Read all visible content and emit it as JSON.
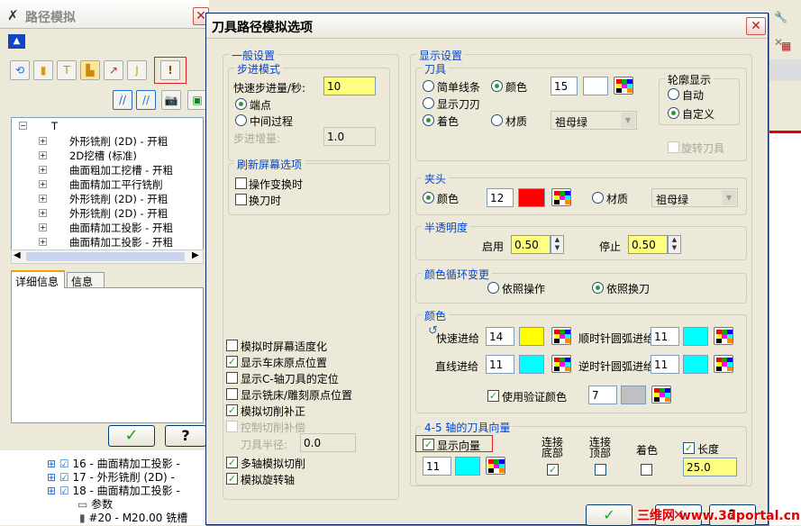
{
  "left_window": {
    "title": "路径模拟",
    "tree_root": "T",
    "tree_items": [
      "外形铣削 (2D) - 开粗",
      "2D挖槽 (标准)",
      "曲面粗加工挖槽 - 开粗",
      "曲面精加工平行铣削",
      "外形铣削 (2D) - 开粗",
      "外形铣削 (2D) - 开粗",
      "曲面精加工投影 - 开粗",
      "曲面精加工投影 - 开粗"
    ],
    "tabs": [
      "详细信息",
      "信息"
    ],
    "ok_icon": "check-icon",
    "help_icon": "question-icon"
  },
  "bottom_tree": [
    {
      "text": "16 - 曲面精加工投影 -"
    },
    {
      "text": "17 - 外形铣削 (2D) -"
    },
    {
      "text": "18 - 曲面精加工投影 -"
    },
    {
      "text": "参数"
    },
    {
      "text": "#20 - M20.00 铣槽"
    }
  ],
  "dialog": {
    "title": "刀具路径模拟选项",
    "general": {
      "title": "一般设置",
      "step_mode": {
        "title": "步进模式",
        "rapid_label": "快速步进量/秒:",
        "rapid_value": "10",
        "endpoint": "端点",
        "intermediate": "中间过程",
        "step_inc_label": "步进增量:",
        "step_inc_value": "1.0"
      },
      "refresh": {
        "title": "刷新屏幕选项",
        "op_change": "操作变换时",
        "tool_change": "换刀时"
      },
      "options": [
        {
          "label": "模拟时屏幕适度化",
          "checked": false,
          "disabled": false
        },
        {
          "label": "显示车床原点位置",
          "checked": true,
          "disabled": false
        },
        {
          "label": "显示C-轴刀具的定位",
          "checked": false,
          "disabled": false
        },
        {
          "label": "显示铣床/雕刻原点位置",
          "checked": false,
          "disabled": false
        },
        {
          "label": "模拟切削补正",
          "checked": true,
          "disabled": false
        },
        {
          "label": "控制切削补偿",
          "checked": false,
          "disabled": true
        }
      ],
      "tool_radius_label": "刀具半径:",
      "tool_radius_value": "0.0",
      "options2": [
        {
          "label": "多轴模拟切削",
          "checked": true
        },
        {
          "label": "模拟旋转轴",
          "checked": true
        }
      ]
    },
    "display": {
      "title": "显示设置",
      "tool": {
        "title": "刀具",
        "simple_line": "简单线条",
        "show_tool": "显示刀刃",
        "shaded": "着色",
        "color": "颜色",
        "material": "材质",
        "color_value": "15",
        "material_value": "祖母绿",
        "contour_title": "轮廓显示",
        "auto": "自动",
        "custom": "自定义",
        "rotate_tool": "旋转刀具"
      },
      "holder": {
        "title": "夹头",
        "color": "颜色",
        "color_value": "12",
        "material": "材质",
        "material_value": "祖母绿"
      },
      "transparency": {
        "title": "半透明度",
        "enable_label": "启用",
        "enable_value": "0.50",
        "stop_label": "停止",
        "stop_value": "0.50"
      },
      "cycle": {
        "title": "颜色循环变更",
        "by_operation": "依照操作",
        "by_tool": "依照换刀"
      },
      "colors": {
        "title": "颜色",
        "rapid_label": "快速进给",
        "rapid_value": "14",
        "cw_label": "顺时针圆弧进给",
        "cw_value": "11",
        "linear_label": "直线进给",
        "linear_value": "11",
        "ccw_label": "逆时针圆弧进给",
        "ccw_value": "11",
        "verify_label": "使用验证颜色",
        "verify_value": "7"
      },
      "axis": {
        "title": "4-5 轴的刀具向量",
        "show_vector": "显示向量",
        "connect_bottom": "连接\n底部",
        "connect_top": "连接\n顶部",
        "shade": "着色",
        "length": "长度",
        "length_value": "25.0",
        "color_value": "11"
      }
    }
  },
  "watermark": "三维网 www.3dportal.cn",
  "colors": {
    "title_blue": "#0046d5",
    "yellow": "#ffff80",
    "cyan": "#00ffff",
    "red": "#ff0000",
    "yellow_sw": "#ffff00",
    "grey_sw": "#c0c0c0"
  }
}
